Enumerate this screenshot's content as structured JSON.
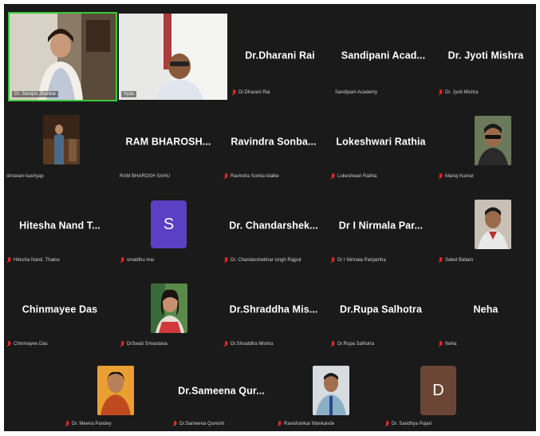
{
  "meeting": {
    "colors": {
      "background": "#1a1a1a",
      "speaker_border": "#3ac93a",
      "muted_icon": "#e02828",
      "avatar_purple": "#5b3fc4",
      "avatar_brown": "#6b4535"
    },
    "video_tiles": [
      {
        "name": "Dr. Sarojini Jhankar",
        "active_speaker": true
      },
      {
        "name": "Vyas"
      }
    ],
    "participants_row1": [
      {
        "name": "Dr.Dharani Rai",
        "label": "Dr.Dharani Rai"
      },
      {
        "name": "Sandipani Acad...",
        "label": "Sandipani Academy"
      },
      {
        "name": "Dr. Jyoti Mishra",
        "label": "Dr. Jyoti Mishra"
      }
    ],
    "participants_row2": [
      {
        "label": "shravani kashyap"
      },
      {
        "name": "RAM BHAROSH...",
        "label": "RAM BHAROSH SAHU"
      },
      {
        "name": "Ravindra Sonba...",
        "label": "Ravindra Sonba Idalke"
      },
      {
        "name": "Lokeshwari Rathia",
        "label": "Lokeshwari Rathia"
      },
      {
        "label": "Manoj Kumar"
      }
    ],
    "participants_row3": [
      {
        "name": "Hitesha Nand T...",
        "label": "Hitesha Nand. Thakur"
      },
      {
        "avatar_letter": "S",
        "label": "smaldhu mai"
      },
      {
        "name": "Dr. Chandarshek...",
        "label": "Dr. Chandarshekhar singh Rajput"
      },
      {
        "name": "Dr I Nirmala Par...",
        "label": "Dr I Nirmala Panjamha"
      },
      {
        "label": "Saket Ballam"
      }
    ],
    "participants_row4": [
      {
        "name": "Chinmayee Das",
        "label": "Chinmayee Das"
      },
      {
        "label": "DrSwati Srivastava"
      },
      {
        "name": "Dr.Shraddha Mis...",
        "label": "Dr.Shraddha Mishra"
      },
      {
        "name": "Dr.Rupa Salhotra",
        "label": "Dr.Rupa Salhotra"
      },
      {
        "name": "Neha",
        "label": "Neha"
      }
    ],
    "participants_row5": [
      {
        "label": "Dr. Meena Pandey"
      },
      {
        "name": "Dr.Sameena Qur...",
        "label": "Dr.Sameena Qureshi"
      },
      {
        "label": "Ravishankar Mankande"
      },
      {
        "avatar_letter": "D",
        "label": "Dr. Sandhya Pujari"
      }
    ]
  }
}
